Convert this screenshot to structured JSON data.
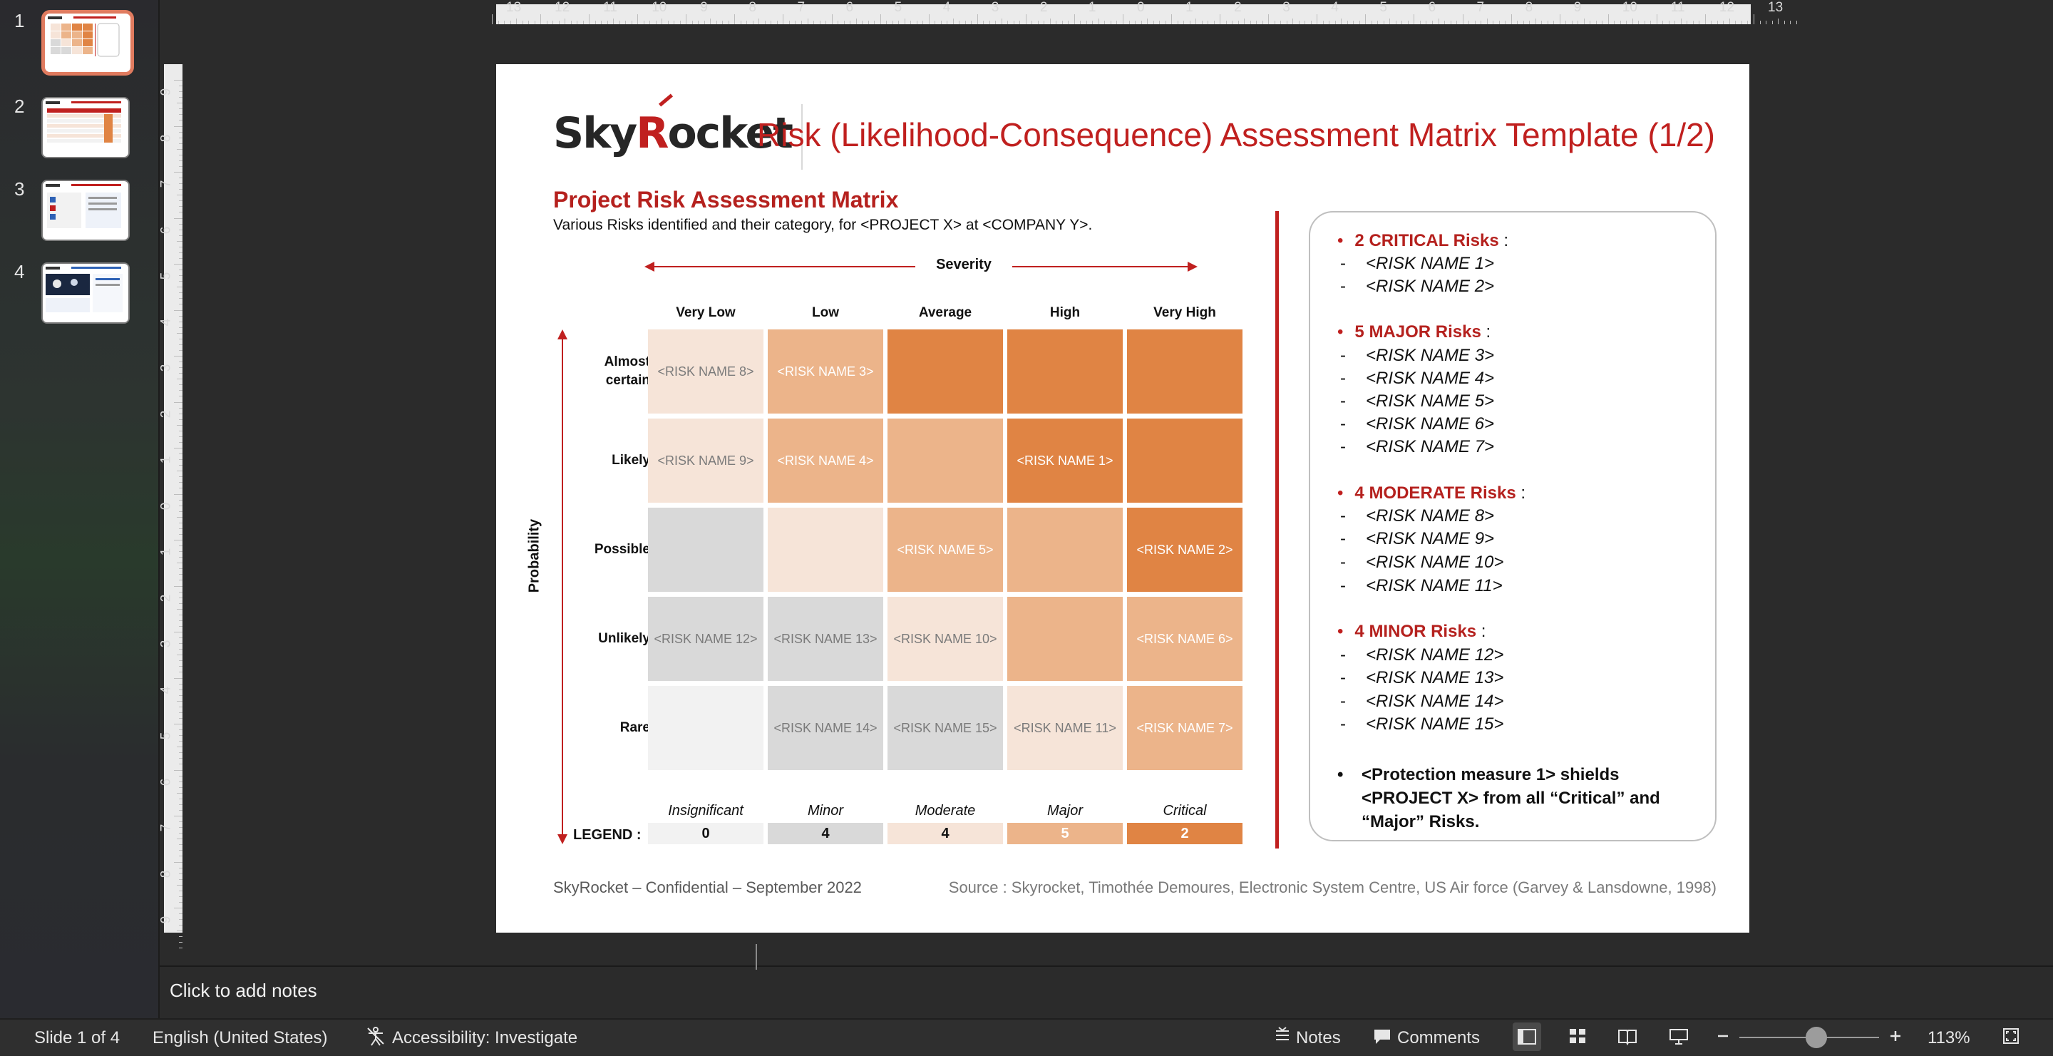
{
  "thumbnails": [
    {
      "num": "1",
      "active": true
    },
    {
      "num": "2",
      "active": false
    },
    {
      "num": "3",
      "active": false
    },
    {
      "num": "4",
      "active": false
    }
  ],
  "ruler": {
    "top_labels": [
      "13",
      "12",
      "11",
      "10",
      "9",
      "8",
      "7",
      "6",
      "5",
      "4",
      "3",
      "2",
      "1",
      "0",
      "1",
      "2",
      "3",
      "4",
      "5",
      "6",
      "7",
      "8",
      "9",
      "10",
      "11",
      "12",
      "13"
    ],
    "left_labels": [
      "9",
      "8",
      "7",
      "6",
      "5",
      "4",
      "3",
      "2",
      "1",
      "0",
      "1",
      "2",
      "3",
      "4",
      "5",
      "6",
      "7",
      "8",
      "9"
    ]
  },
  "slide": {
    "logo": {
      "part1": "Sky",
      "r": "R",
      "part2": "ocket"
    },
    "title": "Risk (Likelihood-Consequence) Assessment Matrix Template (1/2)",
    "subheading": "Project Risk Assessment Matrix",
    "subtext": "Various Risks identified and their category, for <PROJECT X> at <COMPANY Y>.",
    "severity_label": "Severity",
    "probability_label": "Probability",
    "columns": [
      "Very Low",
      "Low",
      "Average",
      "High",
      "Very High"
    ],
    "rows": [
      {
        "label": "Almost certain",
        "cells": [
          {
            "text": "<RISK NAME 8>",
            "color": "#f6e4d8",
            "fg": "#7b7b7b"
          },
          {
            "text": "<RISK NAME 3>",
            "color": "#ecb48a",
            "fg": "#ffffff"
          },
          {
            "text": "",
            "color": "#e08444",
            "fg": "#ffffff"
          },
          {
            "text": "",
            "color": "#e08444",
            "fg": "#ffffff"
          },
          {
            "text": "",
            "color": "#e08444",
            "fg": "#ffffff"
          }
        ]
      },
      {
        "label": "Likely",
        "cells": [
          {
            "text": "<RISK NAME 9>",
            "color": "#f6e4d8",
            "fg": "#7b7b7b"
          },
          {
            "text": "<RISK NAME 4>",
            "color": "#ecb48a",
            "fg": "#ffffff"
          },
          {
            "text": "",
            "color": "#ecb48a",
            "fg": "#ffffff"
          },
          {
            "text": "<RISK NAME 1>",
            "color": "#e08444",
            "fg": "#ffffff"
          },
          {
            "text": "",
            "color": "#e08444",
            "fg": "#ffffff"
          }
        ]
      },
      {
        "label": "Possible",
        "cells": [
          {
            "text": "",
            "color": "#d9d9d9",
            "fg": "#7b7b7b"
          },
          {
            "text": "",
            "color": "#f6e4d8",
            "fg": "#7b7b7b"
          },
          {
            "text": "<RISK NAME 5>",
            "color": "#ecb48a",
            "fg": "#ffffff"
          },
          {
            "text": "",
            "color": "#ecb48a",
            "fg": "#ffffff"
          },
          {
            "text": "<RISK NAME 2>",
            "color": "#e08444",
            "fg": "#ffffff"
          }
        ]
      },
      {
        "label": "Unlikely",
        "cells": [
          {
            "text": "<RISK NAME 12>",
            "color": "#d9d9d9",
            "fg": "#7b7b7b"
          },
          {
            "text": "<RISK NAME 13>",
            "color": "#d9d9d9",
            "fg": "#7b7b7b"
          },
          {
            "text": "<RISK NAME 10>",
            "color": "#f6e4d8",
            "fg": "#7b7b7b"
          },
          {
            "text": "",
            "color": "#ecb48a",
            "fg": "#ffffff"
          },
          {
            "text": "<RISK NAME 6>",
            "color": "#ecb48a",
            "fg": "#ffffff"
          }
        ]
      },
      {
        "label": "Rare",
        "cells": [
          {
            "text": "",
            "color": "#f2f2f2",
            "fg": "#7b7b7b"
          },
          {
            "text": "<RISK NAME 14>",
            "color": "#d9d9d9",
            "fg": "#7b7b7b"
          },
          {
            "text": "<RISK NAME 15>",
            "color": "#d9d9d9",
            "fg": "#7b7b7b"
          },
          {
            "text": "<RISK NAME 11>",
            "color": "#f6e4d8",
            "fg": "#7b7b7b"
          },
          {
            "text": "<RISK NAME 7>",
            "color": "#ecb48a",
            "fg": "#ffffff"
          }
        ]
      }
    ],
    "legend": {
      "title": "LEGEND :",
      "items": [
        {
          "name": "Insignificant",
          "count": "0",
          "color": "#f2f2f2",
          "fg": "#111111"
        },
        {
          "name": "Minor",
          "count": "4",
          "color": "#d9d9d9",
          "fg": "#111111"
        },
        {
          "name": "Moderate",
          "count": "4",
          "color": "#f6e4d8",
          "fg": "#111111"
        },
        {
          "name": "Major",
          "count": "5",
          "color": "#ecb48a",
          "fg": "#ffffff"
        },
        {
          "name": "Critical",
          "count": "2",
          "color": "#e08444",
          "fg": "#ffffff"
        }
      ]
    },
    "summary": {
      "groups": [
        {
          "count": "2",
          "category": "CRITICAL Risks",
          "items": [
            "<RISK NAME 1>",
            "<RISK NAME 2>"
          ]
        },
        {
          "count": "5",
          "category": "MAJOR Risks",
          "items": [
            "<RISK NAME 3>",
            "<RISK NAME 4>",
            "<RISK NAME 5>",
            "<RISK NAME 6>",
            "<RISK NAME 7>"
          ]
        },
        {
          "count": "4",
          "category": "MODERATE Risks",
          "items": [
            "<RISK NAME 8>",
            "<RISK NAME 9>",
            "<RISK NAME 10>",
            "<RISK NAME 11>"
          ]
        },
        {
          "count": "4",
          "category": "MINOR Risks",
          "items": [
            "<RISK NAME 12>",
            "<RISK NAME 13>",
            "<RISK NAME 14>",
            "<RISK NAME 15>"
          ]
        }
      ],
      "protection": "<Protection measure 1> shields <PROJECT X> from all “Critical” and “Major” Risks."
    },
    "footer_left": "SkyRocket – Confidential – September 2022",
    "footer_right": "Source : Skyrocket, Timothée Demoures, Electronic System Centre, US Air force (Garvey & Lansdowne, 1998)"
  },
  "notes_placeholder": "Click to add notes",
  "statusbar": {
    "slide_indicator": "Slide 1 of 4",
    "language": "English (United States)",
    "accessibility": "Accessibility: Investigate",
    "notes_label": "Notes",
    "comments_label": "Comments",
    "zoom_level": "113%",
    "zoom_fraction": 0.55
  }
}
